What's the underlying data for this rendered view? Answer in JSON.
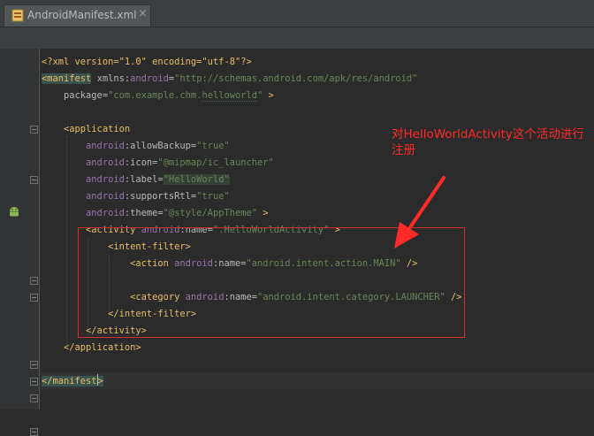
{
  "tab": {
    "label": "AndroidManifest.xml",
    "close": "×",
    "icon": "xml-file-icon"
  },
  "gutter_icon": "android-icon",
  "code_lines": [
    {
      "parts": [
        {
          "c": "pi",
          "t": "<?xml version=\"1.0\" encoding=\"utf-8\"?>"
        }
      ]
    },
    {
      "parts": [
        {
          "c": "tag hl-tag",
          "t": "<manifest"
        },
        {
          "c": "attr",
          "t": " xmlns:"
        },
        {
          "c": "ns",
          "t": "android"
        },
        {
          "c": "attr",
          "t": "="
        },
        {
          "c": "val",
          "t": "\"http://schemas.android.com/apk/res/android\""
        }
      ]
    },
    {
      "parts": [
        {
          "c": "attr",
          "t": "    package="
        },
        {
          "c": "val",
          "t": "\"com.example.chm."
        },
        {
          "c": "val squig",
          "t": "helloworld"
        },
        {
          "c": "val",
          "t": "\""
        },
        {
          "c": "tag",
          "t": " >"
        }
      ]
    },
    {
      "parts": [
        {
          "c": "attr",
          "t": ""
        }
      ]
    },
    {
      "parts": [
        {
          "c": "tag",
          "t": "    <application"
        }
      ]
    },
    {
      "parts": [
        {
          "c": "ns",
          "t": "        android"
        },
        {
          "c": "attr",
          "t": ":allowBackup="
        },
        {
          "c": "val",
          "t": "\"true\""
        }
      ]
    },
    {
      "parts": [
        {
          "c": "ns",
          "t": "        android"
        },
        {
          "c": "attr",
          "t": ":icon="
        },
        {
          "c": "val",
          "t": "\"@mipmap/ic_launcher\""
        }
      ]
    },
    {
      "parts": [
        {
          "c": "ns",
          "t": "        android"
        },
        {
          "c": "attr",
          "t": ":label="
        },
        {
          "c": "val val-box",
          "t": "\"HelloWorld\""
        }
      ]
    },
    {
      "parts": [
        {
          "c": "ns",
          "t": "        android"
        },
        {
          "c": "attr",
          "t": ":supportsRtl="
        },
        {
          "c": "val",
          "t": "\"true\""
        }
      ]
    },
    {
      "parts": [
        {
          "c": "ns",
          "t": "        android"
        },
        {
          "c": "attr",
          "t": ":theme="
        },
        {
          "c": "val",
          "t": "\"@style/AppTheme\""
        },
        {
          "c": "tag",
          "t": " >"
        }
      ]
    },
    {
      "parts": [
        {
          "c": "tag",
          "t": "        <activity "
        },
        {
          "c": "ns",
          "t": "android"
        },
        {
          "c": "attr",
          "t": ":name="
        },
        {
          "c": "val",
          "t": "\".HelloWorldActivity\""
        },
        {
          "c": "tag",
          "t": " >"
        }
      ]
    },
    {
      "parts": [
        {
          "c": "tag",
          "t": "            <intent-filter>"
        }
      ]
    },
    {
      "parts": [
        {
          "c": "tag",
          "t": "                <action "
        },
        {
          "c": "ns",
          "t": "android"
        },
        {
          "c": "attr",
          "t": ":name="
        },
        {
          "c": "val",
          "t": "\"android.intent.action.MAIN\""
        },
        {
          "c": "tag",
          "t": " />"
        }
      ]
    },
    {
      "parts": [
        {
          "c": "attr",
          "t": ""
        }
      ]
    },
    {
      "parts": [
        {
          "c": "tag",
          "t": "                <category "
        },
        {
          "c": "ns",
          "t": "android"
        },
        {
          "c": "attr",
          "t": ":name="
        },
        {
          "c": "val",
          "t": "\"android.intent.category.LAUNCHER\""
        },
        {
          "c": "tag",
          "t": " />"
        }
      ]
    },
    {
      "parts": [
        {
          "c": "tag",
          "t": "            </intent-filter>"
        }
      ]
    },
    {
      "parts": [
        {
          "c": "tag",
          "t": "        </activity>"
        }
      ]
    },
    {
      "parts": [
        {
          "c": "tag",
          "t": "    </application>"
        }
      ]
    },
    {
      "parts": [
        {
          "c": "attr",
          "t": ""
        }
      ]
    },
    {
      "parts": [
        {
          "c": "tag hl-tag",
          "t": "</manifest"
        },
        {
          "c": "caret",
          "t": ""
        },
        {
          "c": "tag hl-tag",
          "t": ">"
        }
      ]
    }
  ],
  "annotation": {
    "text": "对HelloWorldActivity这个活动进行注册",
    "color": "#ff2a2a"
  },
  "colors": {
    "background": "#2b2b2b",
    "tag": "#e8bf6a",
    "value": "#6a8759",
    "namespace": "#9876aa",
    "annotation_box": "#d32f2f"
  }
}
